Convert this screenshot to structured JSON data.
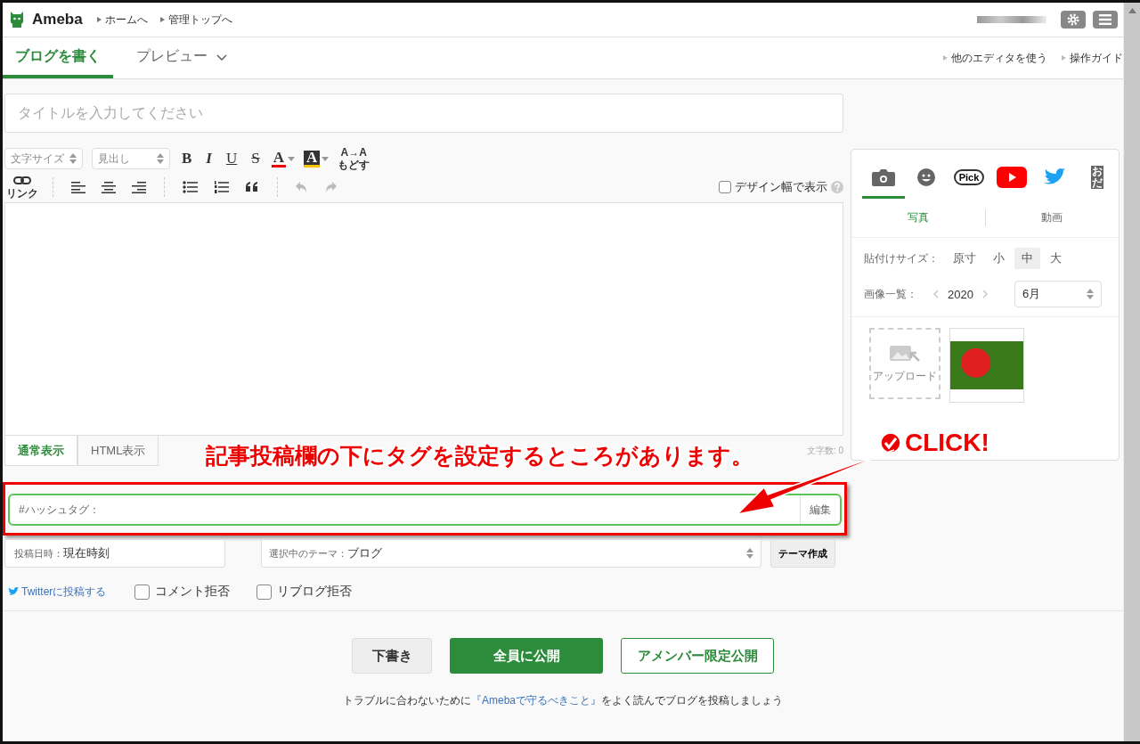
{
  "header": {
    "logo": "Ameba",
    "nav_links": [
      "ホームへ",
      "管理トップへ"
    ]
  },
  "tabs": [
    {
      "label": "ブログを書く",
      "selected": true
    },
    {
      "label": "プレビュー",
      "selected": false
    }
  ],
  "side_links": [
    "他のエディタを使う",
    "操作ガイド"
  ],
  "title_field": {
    "placeholder": "タイトルを入力してください"
  },
  "toolbar": {
    "selects": [
      "文字サイズ",
      "見出し"
    ],
    "format_buttons": [
      "B",
      "I",
      "U",
      "S"
    ],
    "text_color": "A",
    "highlight": "A",
    "revert": {
      "mark": "A→A",
      "label": "もどす"
    },
    "link": "リンク"
  },
  "design_width": {
    "label": "デザイン幅で表示",
    "checked": false
  },
  "editor_tabs": [
    {
      "label": "通常表示",
      "selected": true
    },
    {
      "label": "HTML表示",
      "selected": false
    }
  ],
  "char_count": "文字数: 0",
  "hashtag": {
    "label": "#ハッシュタグ：",
    "button": "編集"
  },
  "post_date": {
    "label": "投稿日時：",
    "value": "現在時刻"
  },
  "theme": {
    "label": "選択中のテーマ：",
    "value": "ブログ",
    "button": "テーマ作成"
  },
  "twitter_link": "Twitterに投稿する",
  "checkboxes": [
    {
      "label": "コメント拒否",
      "checked": false
    },
    {
      "label": "リブログ拒否",
      "checked": false
    }
  ],
  "actions": [
    {
      "label": "下書き",
      "kind": "draft"
    },
    {
      "label": "全員に公開",
      "kind": "primary"
    },
    {
      "label": "アメンバー限定公開",
      "kind": "outline"
    }
  ],
  "notice": {
    "before": "トラブルに合わないために",
    "link": "『Amebaで守るべきこと』",
    "after": "をよく読んでブログを投稿しましょう"
  },
  "side_panel": {
    "media_tabs": [
      {
        "kind": "camera",
        "selected": true
      },
      {
        "kind": "emoji",
        "selected": false
      },
      {
        "kind": "pick",
        "label": "Pick",
        "selected": false
      },
      {
        "kind": "youtube",
        "selected": false
      },
      {
        "kind": "twitter",
        "selected": false
      },
      {
        "kind": "odai",
        "label": "おだ",
        "selected": false
      }
    ],
    "sub_tabs": [
      {
        "label": "写真",
        "selected": true
      },
      {
        "label": "動画",
        "selected": false
      }
    ],
    "paste_size": {
      "label": "貼付けサイズ：",
      "options": [
        {
          "label": "原寸",
          "selected": false
        },
        {
          "label": "小",
          "selected": false
        },
        {
          "label": "中",
          "selected": true
        },
        {
          "label": "大",
          "selected": false
        }
      ]
    },
    "image_list": {
      "label": "画像一覧：",
      "year": "2020",
      "month": "6月"
    },
    "upload": "アップロード"
  },
  "annotation": {
    "caption": "記事投稿欄の下にタグを設定するところがあります。",
    "callout": "CLICK!"
  }
}
